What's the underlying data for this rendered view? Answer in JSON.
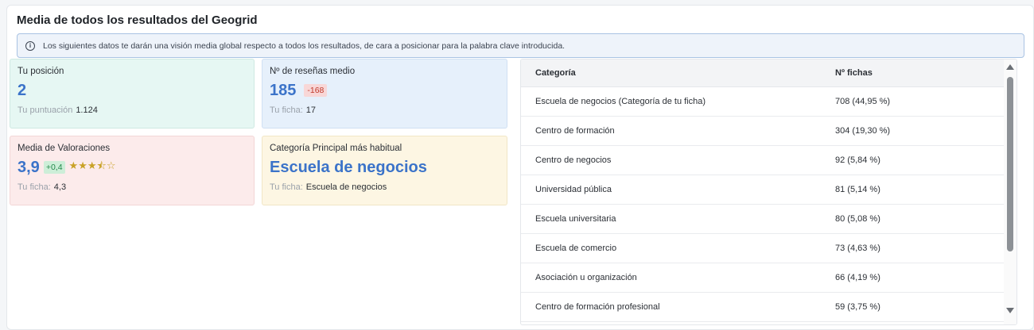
{
  "title": "Media de todos los resultados del Geogrid",
  "info": {
    "icon": "info-icon",
    "text": "Los siguientes datos te darán una visión media global respecto a todos los resultados, de cara a posicionar para la palabra clave introducida."
  },
  "cards": {
    "position": {
      "label": "Tu posición",
      "value": "2",
      "sub_label": "Tu puntuación",
      "sub_value": "1.124"
    },
    "reviews": {
      "label": "Nº de reseñas medio",
      "value": "185",
      "delta": "-168",
      "sub_label": "Tu ficha:",
      "sub_value": "17"
    },
    "ratings": {
      "label": "Media de Valoraciones",
      "value": "3,9",
      "delta": "+0,4",
      "stars_filled": "★★★",
      "stars_half": "⯪",
      "stars_empty": "☆",
      "sub_label": "Tu ficha:",
      "sub_value": "4,3"
    },
    "category": {
      "label": "Categoría Principal más habitual",
      "value": "Escuela de negocios",
      "sub_label": "Tu ficha:",
      "sub_value": "Escuela de negocios"
    }
  },
  "table": {
    "headers": [
      "Categoría",
      "Nº fichas"
    ],
    "rows": [
      [
        "Escuela de negocios (Categoría de tu ficha)",
        "708 (44,95 %)"
      ],
      [
        "Centro de formación",
        "304 (19,30 %)"
      ],
      [
        "Centro de negocios",
        "92 (5,84 %)"
      ],
      [
        "Universidad pública",
        "81 (5,14 %)"
      ],
      [
        "Escuela universitaria",
        "80 (5,08 %)"
      ],
      [
        "Escuela de comercio",
        "73 (4,63 %)"
      ],
      [
        "Asociación u organización",
        "66 (4,19 %)"
      ],
      [
        "Centro de formación profesional",
        "59 (3,75 %)"
      ]
    ]
  },
  "colors": {
    "accent": "#3b73c9",
    "star": "#c9a227",
    "negative": "#c0392b",
    "positive": "#23894a"
  }
}
